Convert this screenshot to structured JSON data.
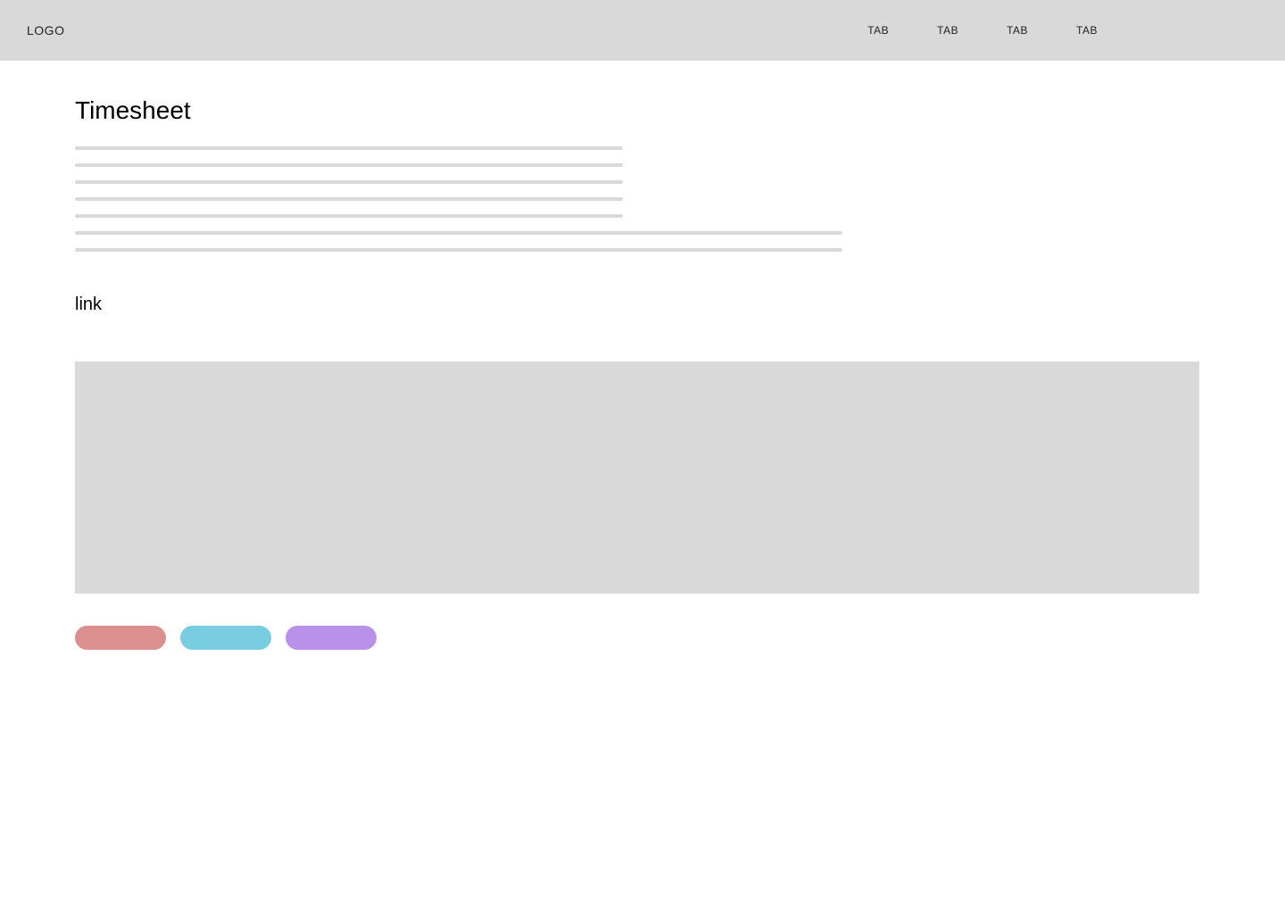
{
  "header": {
    "logo": "LOGO",
    "tabs": [
      "TAB",
      "TAB",
      "TAB",
      "TAB"
    ]
  },
  "page": {
    "title": "Timesheet",
    "link_label": "link"
  },
  "pills": [
    {
      "name": "pill-1",
      "color": "#dc8f8f"
    },
    {
      "name": "pill-2",
      "color": "#79cde0"
    },
    {
      "name": "pill-3",
      "color": "#b991e8"
    }
  ]
}
